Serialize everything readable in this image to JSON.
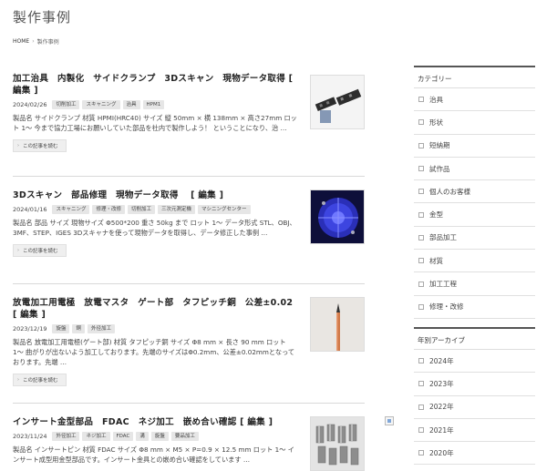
{
  "page": {
    "title": "製作事例"
  },
  "breadcrumb": {
    "home": "HOME",
    "separator": "›",
    "current": "製作事例"
  },
  "readmore_label": "この記事を読む",
  "articles": [
    {
      "title": "加工治具　内製化　サイドクランプ　3Dスキャン　現物データ取得",
      "edit": "[ 編集 ]",
      "date": "2024/02/26",
      "tags": [
        "切削加工",
        "スキャニング",
        "治具",
        "HPM1"
      ],
      "excerpt": "製品名 サイドクランプ 材質 HPMI(HRC40) サイズ 縦 50mm × 横 138mm × 高さ27mm ロット 1〜 今まで協力工場にお願いしていた部品を社内で製作しよう！ ということになり、治 …",
      "thumb": "clamp-photo"
    },
    {
      "title": "3Dスキャン　部品修理　現物データ取得　",
      "edit": "[ 編集 ]",
      "date": "2024/01/16",
      "tags": [
        "スキャニング",
        "修理・改修",
        "切削加工",
        "三次元測定機",
        "マシニングセンター"
      ],
      "excerpt": "製品名 部品 サイズ 現物サイズ Φ500*200 重さ 50kg まで ロット 1〜 データ形式 STL、OBJ、3MF、STEP、IGES 3Dスキャナを使って現物データを取得し、データ修正した事例 …",
      "thumb": "scan-photo"
    },
    {
      "title": "放電加工用電極　放電マスタ　ゲート部　タフピッチ銅　公差±0.02",
      "edit": "[ 編集 ]",
      "date": "2023/12/19",
      "tags": [
        "旋盤",
        "銅",
        "外径加工"
      ],
      "excerpt": "製品名 放電加工用電極(ゲート部) 材質 タフピッチ銅 サイズ Φ8 mm × 長さ 90 mm ロット 1〜 曲がりが出ないよう加工しております。先端のサイズはΦ0.2mm、公差±0.02mmとなっております。先端 …",
      "thumb": "electrode-photo"
    },
    {
      "title": "インサート金型部品　FDAC　ネジ加工　嵌め合い確認",
      "edit": "[ 編集 ]",
      "date": "2023/11/24",
      "tags": [
        "外径加工",
        "ネジ加工",
        "FDAC",
        "溝",
        "旋盤",
        "要品加工"
      ],
      "excerpt": "製品名 インサートピン 材質 FDAC サイズ Φ8 mm × M5 × P=0.9 × 12.5 mm ロット 1〜 インサート成型用金型部品です。インサート金具との嵌め合い確認をしています …",
      "thumb": "insert-photo"
    }
  ],
  "sidebar": {
    "categories_title": "カテゴリー",
    "categories": [
      "治具",
      "形状",
      "短納期",
      "試作品",
      "個人のお客様",
      "金型",
      "部品加工",
      "材質",
      "加工工程",
      "修理・改修"
    ],
    "archive_title": "年別アーカイブ",
    "archives": [
      "2024年",
      "2023年",
      "2022年",
      "2021年",
      "2020年"
    ]
  }
}
